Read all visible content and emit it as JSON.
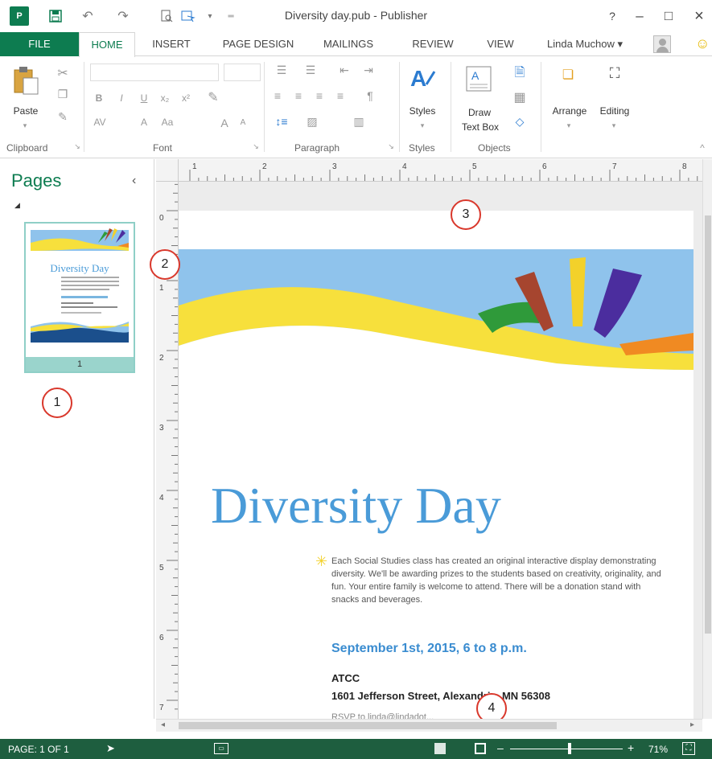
{
  "window": {
    "title": "Diversity day.pub - Publisher",
    "help": "?",
    "minimize": "–",
    "maximize": "□",
    "close": "×"
  },
  "qat": {
    "app": "P",
    "save": "H",
    "undo": "↶",
    "redo": "↷"
  },
  "tabs": [
    "FILE",
    "HOME",
    "INSERT",
    "PAGE DESIGN",
    "MAILINGS",
    "REVIEW",
    "VIEW"
  ],
  "active_tab": "HOME",
  "user": "Linda Muchow ▾",
  "ribbon": {
    "clipboard": {
      "paste": "Paste",
      "label": "Clipboard"
    },
    "font": {
      "label": "Font",
      "bold": "B",
      "italic": "I",
      "underline": "U",
      "subscript": "x₂",
      "superscript": "x²",
      "spacing": "AV",
      "color": "A",
      "case": "Aa",
      "grow": "A",
      "shrink": "A"
    },
    "paragraph": {
      "label": "Paragraph",
      "pilcrow": "¶"
    },
    "styles": {
      "button": "Styles",
      "label": "Styles"
    },
    "objects": {
      "draw": "Draw",
      "text_box": "Text Box",
      "label": "Objects"
    },
    "arrange": "Arrange",
    "editing": "Editing"
  },
  "pages_pane": {
    "title": "Pages",
    "collapse": "‹",
    "thumbnail_number": "1",
    "thumb_title": "Diversity Day"
  },
  "callouts": [
    "1",
    "2",
    "3",
    "4"
  ],
  "ruler": {
    "top_labels": [
      "1",
      "2",
      "3",
      "4",
      "5",
      "6",
      "7",
      "8"
    ],
    "left_labels": [
      "0",
      "1",
      "2",
      "3",
      "4",
      "5",
      "6",
      "7"
    ]
  },
  "document": {
    "headline": "Diversity Day",
    "body": "Each Social Studies class has created an original interactive display demonstrating diversity. We'll be awarding prizes to the students based on creativity, originality, and fun. Your entire family is welcome to attend. There will be a donation stand with snacks and beverages.",
    "date": "September 1st, 2015, 6 to 8 p.m.",
    "venue": "ATCC",
    "address": "1601 Jefferson Street, Alexandria, MN 56308",
    "rsvp": "RSVP to linda@lindadot..."
  },
  "status": {
    "page": "PAGE: 1 OF 1",
    "zoom": "71%",
    "zoom_level_percent": 71
  },
  "colors": {
    "accent": "#0d7c50",
    "status_bar": "#1e5e3f",
    "callout": "#d9382c",
    "headline": "#4a9bd8",
    "banner_sky": "#8fc3ec",
    "banner_yellow": "#f7e03c",
    "ray_green": "#2f9a3a",
    "ray_brown": "#a6452f",
    "ray_yellow": "#f3d12a",
    "ray_purple": "#4b2d9e",
    "ray_orange": "#f08a22"
  }
}
